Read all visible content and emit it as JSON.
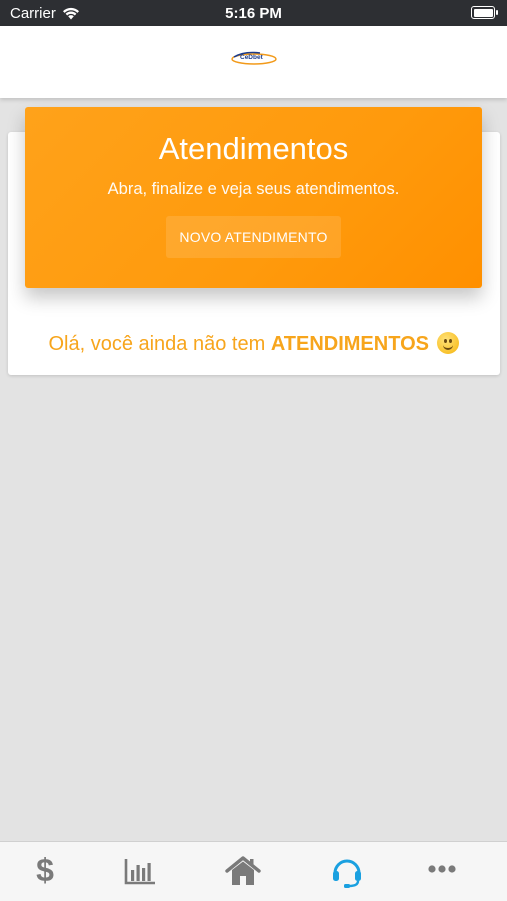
{
  "status_bar": {
    "carrier": "Carrier",
    "time": "5:16 PM"
  },
  "header": {
    "logo_text": "CeDbet"
  },
  "hero": {
    "title": "Atendimentos",
    "subtitle": "Abra, finalize e veja seus atendimentos.",
    "button_label": "NOVO ATENDIMENTO"
  },
  "empty_state": {
    "text": "Olá, você ainda não tem",
    "highlight": "ATENDIMENTOS"
  },
  "tab_bar": {
    "items": [
      {
        "icon": "dollar-icon",
        "symbol": "$",
        "active": false
      },
      {
        "icon": "bar-chart-icon",
        "active": false
      },
      {
        "icon": "home-icon",
        "active": false
      },
      {
        "icon": "headset-icon",
        "active": true
      },
      {
        "icon": "more-icon",
        "active": false
      }
    ]
  },
  "colors": {
    "accent": "#ff9a0c",
    "active_tab": "#1aa0e0",
    "inactive_tab": "#7a7a7a"
  }
}
